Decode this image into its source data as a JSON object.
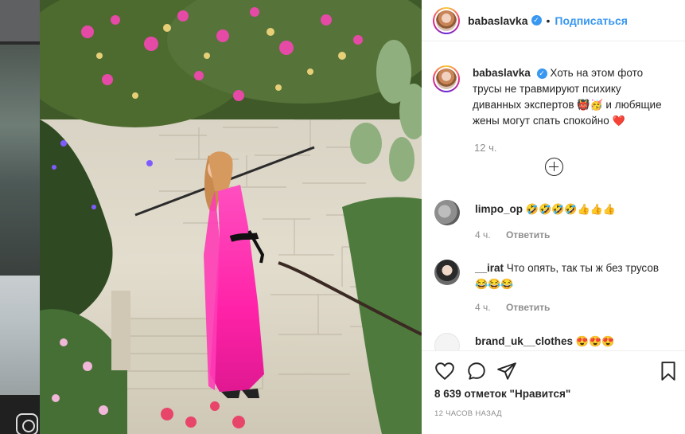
{
  "post": {
    "username": "babaslavka",
    "verified_mark": "✓",
    "dot": "•",
    "follow_label": "Подписаться"
  },
  "caption": {
    "username": "babaslavka",
    "text_a": "Хоть на этом фото трусы не травмируют психику диванных экспертов",
    "emoji_a": "👹🥳",
    "text_b": "и любящие жены могут спать спокойно",
    "emoji_b": "❤️",
    "time": "12 ч."
  },
  "comments": [
    {
      "username": "limpo_op",
      "text": "🤣🤣🤣🤣👍👍👍",
      "time": "4 ч.",
      "reply": "Ответить"
    },
    {
      "username": "__irat",
      "text": "Что опять, так ты ж без трусов",
      "emoji": "😂😂😂",
      "time": "4 ч.",
      "reply": "Ответить"
    },
    {
      "username": "brand_uk__clothes",
      "text": "😍😍😍"
    }
  ],
  "footer": {
    "likes": "8 639 отметок \"Нравится\"",
    "ago": "12 часов назад"
  },
  "icons": {
    "like": "heart-icon",
    "comment": "comment-icon",
    "share": "share-icon",
    "save": "bookmark-icon",
    "add": "plus-circle-icon"
  },
  "colors": {
    "accent": "#3897f0",
    "text": "#262626",
    "muted": "#8e8e8e",
    "dress": "#ff2fb3"
  }
}
